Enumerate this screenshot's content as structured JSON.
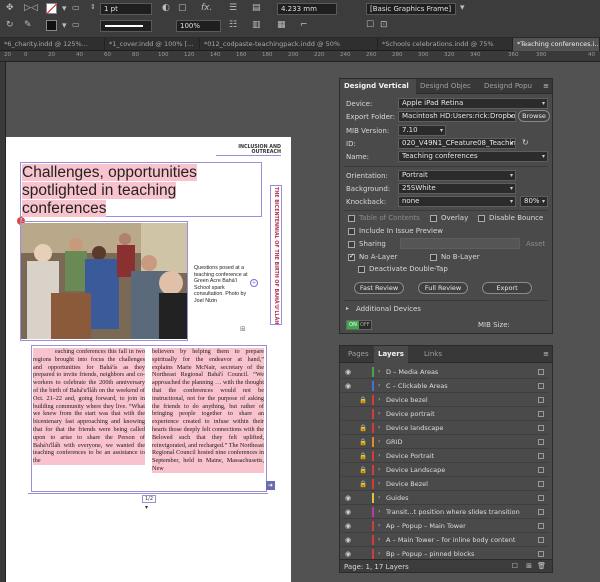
{
  "control_bar": {
    "stroke_weight": "1 pt",
    "zoom_percent": "100%",
    "width_value": "4.233 mm",
    "object_style": "[Basic Graphics Frame]"
  },
  "doc_tabs": [
    {
      "label": "*6_charity.indd @ 125%..."
    },
    {
      "label": "*1_cover.indd @ 100% [..."
    },
    {
      "label": "*012_codpaste-teachingpack.indd @ 50%"
    },
    {
      "label": "*Schools celebrations.indd @ 75%"
    },
    {
      "label": "*Teaching conferences.i..."
    }
  ],
  "ruler_ticks": [
    "20",
    "0",
    "20",
    "40",
    "60",
    "80",
    "100",
    "120",
    "140",
    "160",
    "180",
    "200",
    "220",
    "240",
    "260",
    "280",
    "300",
    "320",
    "340",
    "360",
    "380",
    "40"
  ],
  "document": {
    "running_head": "INCLUSION AND OUTREACH",
    "headline": "Challenges, opportunities spotlighted in teaching conferences",
    "side_label": "THE BICENTENNIAL OF THE BIRTH OF BAHÁ'U'LLÁH",
    "caption": "Questions posed at a teaching conference at Green Acre Bahá'í School spark consultation. Photo by Joel Nizin",
    "drop_cap": "T",
    "col1": "eaching conferences this fall in two regions brought into focus the challenges and opportunities for Bahá'ís as they prepared to invite friends, neighbors and co-workers to celebrate the 200th anniversary of the birth of Bahá'u'lláh on the weekend of Oct. 21–22 and, going forward, to join in building community where they live. “What we knew from the start was that with the bicentenary fast approaching and knowing that for that the friends were being called upon to arise to share the Person of Bahá'u'lláh with everyone, we wanted the teaching conferences to be an assistance to the",
    "col2": "believers by helping them to prepare spiritually for the endeavor at hand,” explains Marie McNair, secretary of the Northeast Regional Bahá'í Council. “We approached the planning … with the thought that the conferences would not be instructional, not for the purpose of asking the friends to do anything, but rather of bringing people together to share an experience created to infuse within their hearts those deeply felt connections with the Beloved such that they felt uplifted, reinvigorated, and recharged.” The Northeast Regional Council hosted nine conferences in September, held in Maine, Massachusetts, New",
    "page_counter": "1/2"
  },
  "designd_panel": {
    "tabs": [
      "Designd Vertical",
      "Designd Objec",
      "Designd Popu"
    ],
    "device_label": "Device:",
    "device_value": "Apple iPad Retina",
    "export_label": "Export Folder:",
    "export_value": "Macintosh HD:Users:rick:Dropbox (B",
    "browse_label": "Browse",
    "mib_version_label": "MIB Version:",
    "mib_version_value": "7.10",
    "id_label": "ID:",
    "id_value": "020_V49N1_CFeature08_TeachingCc",
    "name_label": "Name:",
    "name_value": "Teaching conferences",
    "orientation_label": "Orientation:",
    "orientation_value": "Portrait",
    "background_label": "Background:",
    "background_value": "25SWhite",
    "knockback_label": "Knockback:",
    "knockback_value": "none",
    "knockback_pct": "80%",
    "toc_label": "Table of Contents",
    "overlay_label": "Overlay",
    "disable_bounce_label": "Disable Bounce",
    "include_preview_label": "Include In Issue Preview",
    "sharing_label": "Sharing",
    "asset_label": "Asset",
    "no_a_layer_label": "No A-Layer",
    "no_b_layer_label": "No B-Layer",
    "deactivate_label": "Deactivate Double-Tap",
    "fast_review_label": "Fast Review",
    "full_review_label": "Full Review",
    "export_btn_label": "Export",
    "additional_devices_label": "Additional Devices",
    "toggle_on": "ON",
    "toggle_off": "OFF",
    "mib_size_label": "MIB Size:"
  },
  "layers_panel": {
    "tabs": [
      "Pages",
      "Layers",
      "Links"
    ],
    "layers": [
      {
        "name": "D – Media Areas",
        "visible": true,
        "locked": false,
        "color": "#3ea84a"
      },
      {
        "name": "C – Clickable Areas",
        "visible": true,
        "locked": false,
        "color": "#4a6de0"
      },
      {
        "name": "Device bezel",
        "visible": false,
        "locked": true,
        "color": "#d83a3a"
      },
      {
        "name": "Device portrait",
        "visible": false,
        "locked": false,
        "color": "#d83a3a"
      },
      {
        "name": "Device landscape",
        "visible": false,
        "locked": true,
        "color": "#d83a3a"
      },
      {
        "name": "GRID",
        "visible": false,
        "locked": true,
        "color": "#e08a2a"
      },
      {
        "name": "Device Portrait",
        "visible": false,
        "locked": true,
        "color": "#d83a3a"
      },
      {
        "name": "Device Landscape",
        "visible": false,
        "locked": true,
        "color": "#d83a3a"
      },
      {
        "name": "Device Bezel",
        "visible": false,
        "locked": true,
        "color": "#d83a3a"
      },
      {
        "name": "Guides",
        "visible": true,
        "locked": false,
        "color": "#e0c43a"
      },
      {
        "name": "Transit...t position where slides transition",
        "visible": true,
        "locked": false,
        "color": "#c03aa0"
      },
      {
        "name": "Ap – Popup – Main Tower",
        "visible": true,
        "locked": false,
        "color": "#d83a3a"
      },
      {
        "name": "A – Main Tower – for inline body content",
        "visible": true,
        "locked": false,
        "color": "#d83a3a"
      },
      {
        "name": "Bp – Popup – pinned blocks",
        "visible": true,
        "locked": false,
        "color": "#d83a3a"
      }
    ],
    "status": "Page: 1, 17 Layers"
  }
}
